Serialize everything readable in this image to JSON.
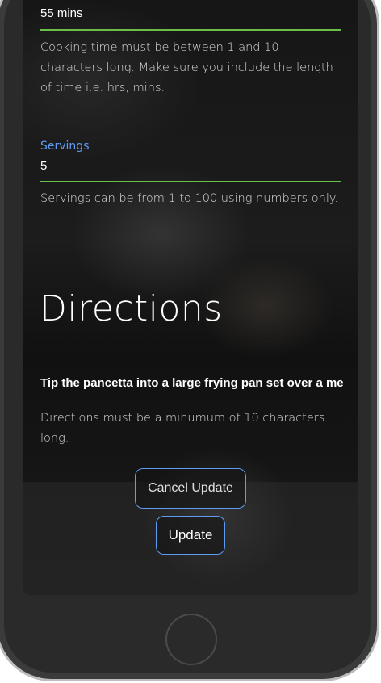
{
  "cooking_time": {
    "value": "55 mins",
    "helper": "Cooking time must be between 1 and 10 characters long. Make sure you include the length of time i.e. hrs, mins."
  },
  "servings": {
    "label": "Servings",
    "value": "5",
    "helper": "Servings can be from 1 to 100 using numbers only."
  },
  "directions": {
    "heading": "Directions",
    "value": "Tip the pancetta into a large frying pan set over a me",
    "helper": "Directions must be a minumum of 10 characters long."
  },
  "buttons": {
    "cancel": "Cancel Update",
    "update": "Update"
  },
  "colors": {
    "accent_blue": "#5f9cf5",
    "valid_green": "#6abf4b"
  }
}
